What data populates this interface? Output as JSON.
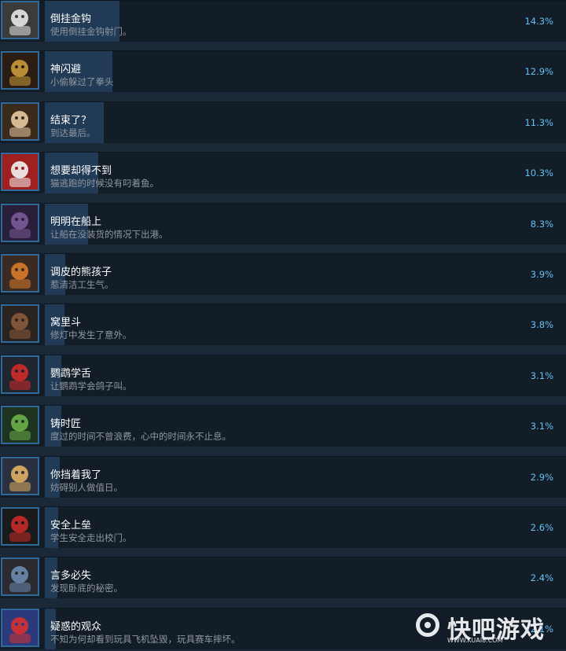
{
  "achievements": [
    {
      "title": "倒挂金钩",
      "desc": "使用倒挂金钩射门。",
      "percent": "14.3%",
      "ratio": 0.143,
      "icon": "soccer-kick-icon",
      "colors": [
        "#e8e8e8",
        "#3b3b3b"
      ]
    },
    {
      "title": "神闪避",
      "desc": "小偷躲过了拳头",
      "percent": "12.9%",
      "ratio": 0.129,
      "icon": "masked-thief-icon",
      "colors": [
        "#c89a3a",
        "#2b1d12"
      ]
    },
    {
      "title": "结束了？",
      "desc": "到达最后。",
      "percent": "11.3%",
      "ratio": 0.113,
      "icon": "open-book-icon",
      "colors": [
        "#e6c9a0",
        "#3a2a1c"
      ]
    },
    {
      "title": "想要却得不到",
      "desc": "猫逃跑的时候没有叼着鱼。",
      "percent": "10.3%",
      "ratio": 0.103,
      "icon": "angry-cat-icon",
      "colors": [
        "#f2f2f2",
        "#a02020"
      ]
    },
    {
      "title": "明明在船上",
      "desc": "让船在没装货的情况下出港。",
      "percent": "8.3%",
      "ratio": 0.083,
      "icon": "mystery-crate-icon",
      "colors": [
        "#7a5a9a",
        "#2a1f3a"
      ]
    },
    {
      "title": "调皮的熊孩子",
      "desc": "惹清洁工生气。",
      "percent": "3.9%",
      "ratio": 0.039,
      "icon": "angry-janitor-icon",
      "colors": [
        "#d97a2a",
        "#3a2a22"
      ]
    },
    {
      "title": "窝里斗",
      "desc": "修灯中发生了意外。",
      "percent": "3.8%",
      "ratio": 0.038,
      "icon": "two-men-icon",
      "colors": [
        "#8a5a3a",
        "#2a2420"
      ]
    },
    {
      "title": "鹦鹉学舌",
      "desc": "让鹦鹉学会鸽子叫。",
      "percent": "3.1%",
      "ratio": 0.031,
      "icon": "parrot-icon",
      "colors": [
        "#d02a2a",
        "#1f2630"
      ]
    },
    {
      "title": "铸时匠",
      "desc": "度过的时间不曾浪费，心中的时间永不止息。",
      "percent": "3.1%",
      "ratio": 0.031,
      "icon": "clock-box-icon",
      "colors": [
        "#6ab04a",
        "#1e3320"
      ]
    },
    {
      "title": "你挡着我了",
      "desc": "妨碍别人做值日。",
      "percent": "2.9%",
      "ratio": 0.029,
      "icon": "girl-broom-icon",
      "colors": [
        "#e0b060",
        "#2a3040"
      ]
    },
    {
      "title": "安全上垒",
      "desc": "学生安全走出校门。",
      "percent": "2.6%",
      "ratio": 0.026,
      "icon": "sneaker-icon",
      "colors": [
        "#c82a2a",
        "#1a1a1a"
      ]
    },
    {
      "title": "言多必失",
      "desc": "发现卧底的秘密。",
      "percent": "2.4%",
      "ratio": 0.024,
      "icon": "man-portrait-icon",
      "colors": [
        "#6a8ab0",
        "#2a2a30"
      ]
    },
    {
      "title": "疑惑的观众",
      "desc": "不知为何却看到玩具飞机坠毁，玩具赛车摔坏。",
      "percent": "2.1%",
      "ratio": 0.021,
      "icon": "toy-plane-icon",
      "colors": [
        "#d83030",
        "#2a3a7a"
      ]
    }
  ],
  "watermark": {
    "text": "快吧游戏",
    "url": "WWW.KUAI8.COM"
  }
}
